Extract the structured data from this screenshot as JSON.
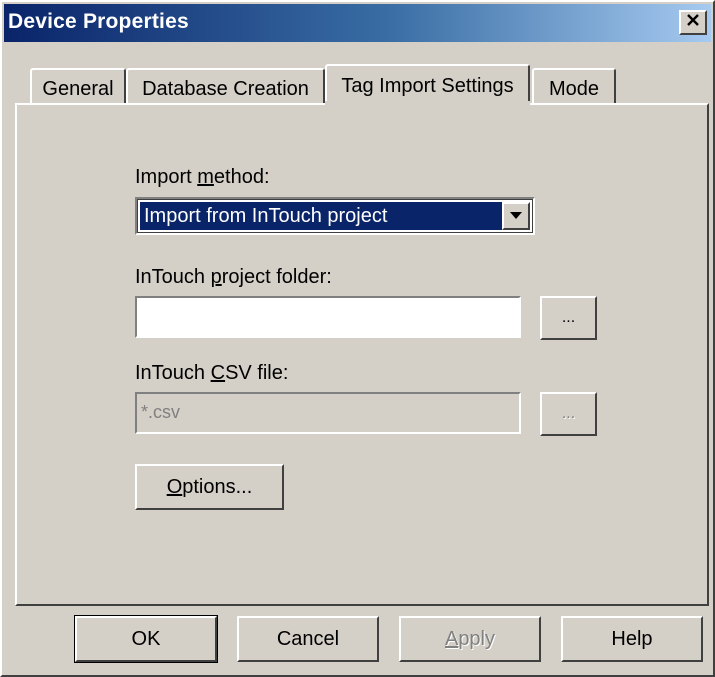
{
  "window": {
    "title": "Device Properties",
    "close_glyph": "✕"
  },
  "tabs": [
    {
      "label": "General",
      "active": false
    },
    {
      "label": "Database Creation",
      "active": false
    },
    {
      "label": "Tag Import Settings",
      "active": true
    },
    {
      "label": "Mode",
      "active": false
    }
  ],
  "form": {
    "import_method_label_pre": "Import ",
    "import_method_label_key": "m",
    "import_method_label_post": "ethod:",
    "import_method_value": "Import from InTouch project",
    "project_folder_label_pre": "InTouch ",
    "project_folder_label_key": "p",
    "project_folder_label_post": "roject folder:",
    "project_folder_value": "",
    "browse_label": "...",
    "csv_label_pre": "InTouch ",
    "csv_label_key": "C",
    "csv_label_post": "SV file:",
    "csv_value": "*.csv",
    "csv_browse_label": "...",
    "options_label_key": "O",
    "options_label_post": "ptions..."
  },
  "footer": {
    "ok_label": "OK",
    "cancel_label": "Cancel",
    "apply_label_key": "A",
    "apply_label_post": "pply",
    "help_label": "Help"
  }
}
